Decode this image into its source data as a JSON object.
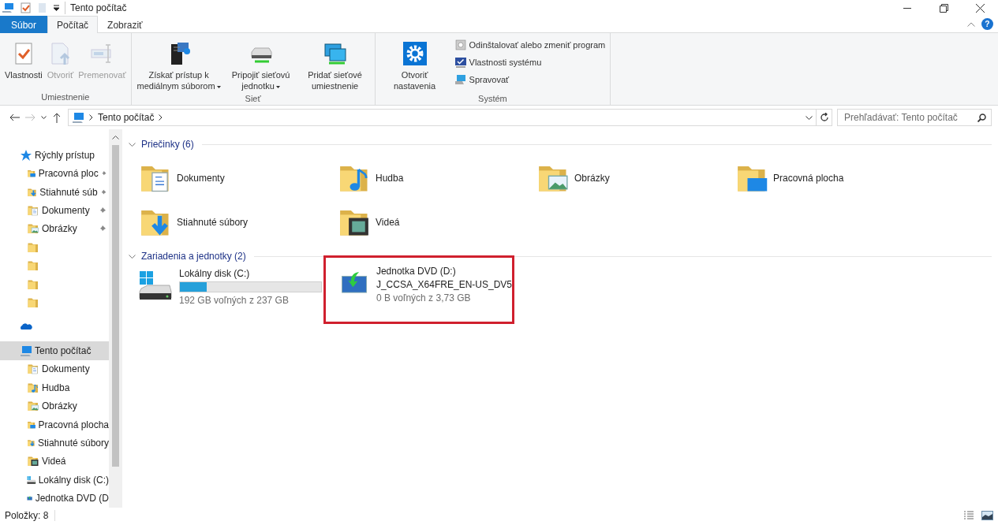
{
  "window": {
    "title": "Tento počítač"
  },
  "tabs": [
    {
      "label": "Súbor",
      "kind": "file",
      "selected": false
    },
    {
      "label": "Počítač",
      "kind": "tab",
      "selected": true
    },
    {
      "label": "Zobraziť",
      "kind": "tab",
      "selected": false
    }
  ],
  "help_button": "?",
  "ribbon": {
    "groups": [
      {
        "label": "Umiestnenie",
        "buttons": [
          {
            "label": "Vlastnosti",
            "kind": "properties",
            "disabled": false,
            "dropdown": false
          },
          {
            "label": "Otvoriť",
            "kind": "open",
            "disabled": true,
            "dropdown": false
          },
          {
            "label": "Premenovať",
            "kind": "rename",
            "disabled": true,
            "dropdown": false
          }
        ]
      },
      {
        "label": "Sieť",
        "buttons": [
          {
            "label": "Získať prístup k mediálnym súborom",
            "kind": "media",
            "disabled": false,
            "dropdown": true
          },
          {
            "label": "Pripojiť sieťovú jednotku",
            "kind": "map",
            "disabled": false,
            "dropdown": true
          },
          {
            "label": "Pridať sieťové umiestnenie",
            "kind": "location",
            "disabled": false,
            "dropdown": false
          }
        ]
      },
      {
        "label": "Systém",
        "buttons": [
          {
            "label": "Otvoriť nastavenia",
            "kind": "settings",
            "disabled": false,
            "dropdown": false
          }
        ],
        "small_buttons": [
          {
            "label": "Odinštalovať alebo zmeniť program",
            "kind": "uninstall"
          },
          {
            "label": "Vlastnosti systému",
            "kind": "sysprops"
          },
          {
            "label": "Spravovať",
            "kind": "manage"
          }
        ]
      }
    ]
  },
  "address": {
    "path": "Tento počítač"
  },
  "search": {
    "placeholder": "Prehľadávať: Tento počítač"
  },
  "nav": [
    {
      "label": "Rýchly prístup",
      "kind": "star",
      "selected": false,
      "children": [
        {
          "label": "Pracovná ploc",
          "kind": "desktop",
          "selected": false,
          "pinned": true
        },
        {
          "label": "Stiahnuté súb",
          "kind": "downloads",
          "selected": false,
          "pinned": true
        },
        {
          "label": "Dokumenty",
          "kind": "documents",
          "selected": false,
          "pinned": true
        },
        {
          "label": "Obrázky",
          "kind": "pictures",
          "selected": false,
          "pinned": true
        },
        {
          "kind": "folder",
          "selected": false,
          "pinned": false
        },
        {
          "kind": "folder",
          "selected": false,
          "pinned": false
        },
        {
          "kind": "folder",
          "selected": false,
          "pinned": false
        },
        {
          "kind": "folder",
          "selected": false,
          "pinned": false
        }
      ]
    },
    {
      "kind": "cloud",
      "selected": false
    },
    {
      "label": "Tento počítač",
      "kind": "pc",
      "selected": true,
      "children": [
        {
          "label": "Dokumenty",
          "kind": "documents",
          "selected": false
        },
        {
          "label": "Hudba",
          "kind": "music",
          "selected": false
        },
        {
          "label": "Obrázky",
          "kind": "pictures",
          "selected": false
        },
        {
          "label": "Pracovná plocha",
          "kind": "desktop",
          "selected": false
        },
        {
          "label": "Stiahnuté súbory",
          "kind": "downloads",
          "selected": false
        },
        {
          "label": "Videá",
          "kind": "videos",
          "selected": false
        },
        {
          "label": "Lokálny disk (C:)",
          "kind": "hdd",
          "selected": false
        },
        {
          "label": "Jednotka DVD (D",
          "kind": "dvd",
          "selected": false
        }
      ]
    }
  ],
  "sections": [
    {
      "title": "Priečinky (6)",
      "expanded": true,
      "folders": [
        {
          "name": "Dokumenty",
          "kind": "documents"
        },
        {
          "name": "Hudba",
          "kind": "music"
        },
        {
          "name": "Obrázky",
          "kind": "pictures"
        },
        {
          "name": "Pracovná plocha",
          "kind": "desktop"
        },
        {
          "name": "Stiahnuté súbory",
          "kind": "downloads"
        },
        {
          "name": "Videá",
          "kind": "videos"
        }
      ]
    },
    {
      "title": "Zariadenia a jednotky (2)",
      "expanded": true,
      "drives": [
        {
          "name": "Lokálny disk (C:)",
          "kind": "hdd",
          "level": 0.19,
          "free": "192 GB voľných z 237 GB",
          "highlighted": false
        },
        {
          "name": "Jednotka DVD (D:)",
          "kind": "dvd",
          "volume": "J_CCSA_X64FRE_EN-US_DV5",
          "free": "0 B voľných z 3,73 GB",
          "highlighted": true
        }
      ]
    }
  ],
  "status_bar": {
    "items": "Položky: 8"
  }
}
